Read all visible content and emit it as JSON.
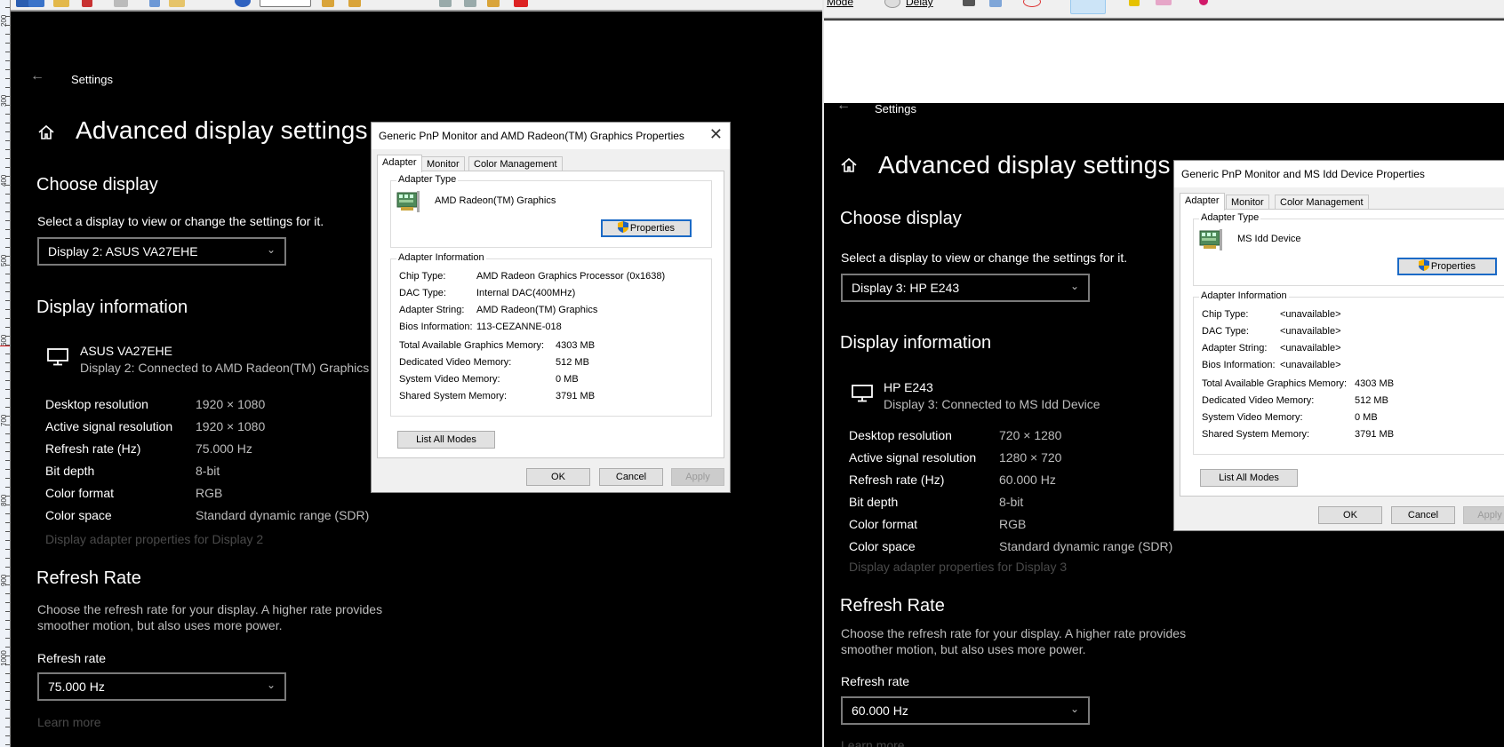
{
  "left_app": {
    "ruler_labels": [
      "200",
      "300",
      "400",
      "500",
      "600",
      "700",
      "800",
      "900",
      "1000"
    ]
  },
  "right_app": {
    "toolbar": {
      "mode_label": "Mode",
      "delay_label": "Delay"
    }
  },
  "left_settings": {
    "window_title": "Settings",
    "page_title": "Advanced display settings",
    "choose_display": {
      "heading": "Choose display",
      "description": "Select a display to view or change the settings for it.",
      "selected": "Display 2: ASUS VA27EHE"
    },
    "display_info": {
      "heading": "Display information",
      "monitor_name": "ASUS VA27EHE",
      "connection": "Display 2: Connected to AMD Radeon(TM) Graphics",
      "rows": [
        {
          "label": "Desktop resolution",
          "value": "1920 × 1080"
        },
        {
          "label": "Active signal resolution",
          "value": "1920 × 1080"
        },
        {
          "label": "Refresh rate (Hz)",
          "value": "75.000 Hz"
        },
        {
          "label": "Bit depth",
          "value": "8-bit"
        },
        {
          "label": "Color format",
          "value": "RGB"
        },
        {
          "label": "Color space",
          "value": "Standard dynamic range (SDR)"
        }
      ],
      "adapter_link": "Display adapter properties for Display 2"
    },
    "refresh": {
      "heading": "Refresh Rate",
      "description_line1": "Choose the refresh rate for your display. A higher rate provides",
      "description_line2": "smoother motion, but also uses more power.",
      "field_label": "Refresh rate",
      "selected": "75.000 Hz",
      "learn_more": "Learn more"
    }
  },
  "left_dialog": {
    "title": "Generic PnP Monitor and AMD Radeon(TM) Graphics Properties",
    "tabs": [
      "Adapter",
      "Monitor",
      "Color Management"
    ],
    "active_tab": "Adapter",
    "adapter_type_label": "Adapter Type",
    "adapter_name": "AMD Radeon(TM) Graphics",
    "properties_button": "Properties",
    "adapter_info_label": "Adapter Information",
    "info_rows": [
      {
        "label": "Chip Type:",
        "value": "AMD Radeon Graphics Processor (0x1638)"
      },
      {
        "label": "DAC Type:",
        "value": "Internal DAC(400MHz)"
      },
      {
        "label": "Adapter String:",
        "value": "AMD Radeon(TM) Graphics"
      },
      {
        "label": "Bios Information:",
        "value": "113-CEZANNE-018"
      }
    ],
    "memory_rows": [
      {
        "label": "Total Available Graphics Memory:",
        "value": "4303 MB"
      },
      {
        "label": "Dedicated Video Memory:",
        "value": "512 MB"
      },
      {
        "label": "System Video Memory:",
        "value": "0 MB"
      },
      {
        "label": "Shared System Memory:",
        "value": "3791 MB"
      }
    ],
    "list_modes_button": "List All Modes",
    "ok_button": "OK",
    "cancel_button": "Cancel",
    "apply_button": "Apply"
  },
  "right_settings": {
    "window_title": "Settings",
    "page_title": "Advanced display settings",
    "choose_display": {
      "heading": "Choose display",
      "description": "Select a display to view or change the settings for it.",
      "selected": "Display 3: HP E243"
    },
    "display_info": {
      "heading": "Display information",
      "monitor_name": "HP E243",
      "connection": "Display 3: Connected to MS Idd Device",
      "rows": [
        {
          "label": "Desktop resolution",
          "value": "720 × 1280"
        },
        {
          "label": "Active signal resolution",
          "value": "1280 × 720"
        },
        {
          "label": "Refresh rate (Hz)",
          "value": "60.000 Hz"
        },
        {
          "label": "Bit depth",
          "value": "8-bit"
        },
        {
          "label": "Color format",
          "value": "RGB"
        },
        {
          "label": "Color space",
          "value": "Standard dynamic range (SDR)"
        }
      ],
      "adapter_link": "Display adapter properties for Display 3"
    },
    "refresh": {
      "heading": "Refresh Rate",
      "description_line1": "Choose the refresh rate for your display. A higher rate provides",
      "description_line2": "smoother motion, but also uses more power.",
      "field_label": "Refresh rate",
      "selected": "60.000 Hz",
      "learn_more": "Learn more"
    }
  },
  "right_dialog": {
    "title": "Generic PnP Monitor and MS Idd Device Properties",
    "tabs": [
      "Adapter",
      "Monitor",
      "Color Management"
    ],
    "active_tab": "Adapter",
    "adapter_type_label": "Adapter Type",
    "adapter_name": "MS Idd Device",
    "properties_button": "Properties",
    "adapter_info_label": "Adapter Information",
    "info_rows": [
      {
        "label": "Chip Type:",
        "value": "<unavailable>"
      },
      {
        "label": "DAC Type:",
        "value": "<unavailable>"
      },
      {
        "label": "Adapter String:",
        "value": "<unavailable>"
      },
      {
        "label": "Bios Information:",
        "value": "<unavailable>"
      }
    ],
    "memory_rows": [
      {
        "label": "Total Available Graphics Memory:",
        "value": "4303 MB"
      },
      {
        "label": "Dedicated Video Memory:",
        "value": "512 MB"
      },
      {
        "label": "System Video Memory:",
        "value": "0 MB"
      },
      {
        "label": "Shared System Memory:",
        "value": "3791 MB"
      }
    ],
    "list_modes_button": "List All Modes",
    "ok_button": "OK",
    "cancel_button": "Cancel",
    "apply_button": "Apply"
  }
}
